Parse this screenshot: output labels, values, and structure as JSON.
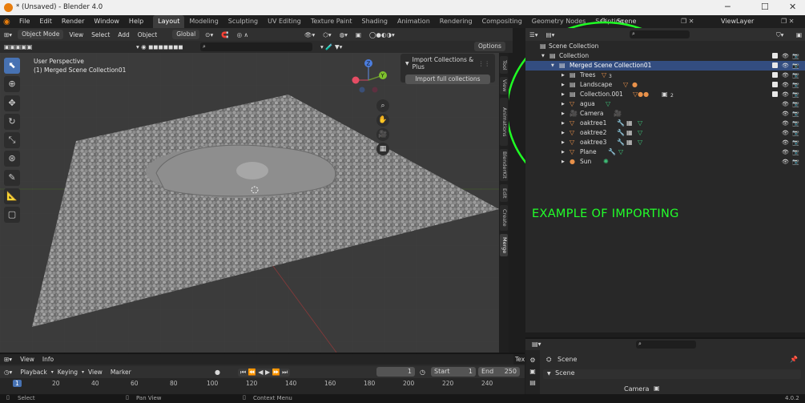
{
  "window": {
    "title": "* (Unsaved) - Blender 4.0"
  },
  "menu": [
    "File",
    "Edit",
    "Render",
    "Window",
    "Help"
  ],
  "workspaces": [
    "Layout",
    "Modeling",
    "Sculpting",
    "UV Editing",
    "Texture Paint",
    "Shading",
    "Animation",
    "Rendering",
    "Compositing",
    "Geometry Nodes",
    "Scripting"
  ],
  "scene_field": "Scene",
  "viewlayer_field": "ViewLayer",
  "vp_header": {
    "mode": "Object Mode",
    "menus": [
      "View",
      "Select",
      "Add",
      "Object"
    ],
    "orientation": "Global",
    "options": "Options"
  },
  "vp_info": {
    "line1": "User Perspective",
    "line2": "(1) Merged Scene Collection01"
  },
  "npanel": {
    "title": "Import Collections & Plus",
    "button": "Import full collections"
  },
  "side_tabs": [
    "Tool",
    "View",
    "Animations",
    "BlenderKit",
    "Edit",
    "Create",
    "Merge"
  ],
  "gizmo": {
    "x": "X",
    "y": "Y",
    "z": "Z"
  },
  "outliner": {
    "rows": [
      {
        "label": "Scene Collection",
        "indent": 0,
        "icon": "collection"
      },
      {
        "label": "Collection",
        "indent": 1,
        "icon": "collection"
      },
      {
        "label": "Merged Scene Collection01",
        "indent": 2,
        "icon": "collection",
        "selected": true
      },
      {
        "label": "Trees",
        "indent": 3,
        "icon": "collection",
        "badge": "3"
      },
      {
        "label": "Landscape",
        "indent": 3,
        "icon": "collection"
      },
      {
        "label": "Collection.001",
        "indent": 3,
        "icon": "collection",
        "badge": "2"
      },
      {
        "label": "agua",
        "indent": 3,
        "icon": "mesh"
      },
      {
        "label": "Camera",
        "indent": 3,
        "icon": "camera"
      },
      {
        "label": "oaktree1",
        "indent": 3,
        "icon": "mesh"
      },
      {
        "label": "oaktree2",
        "indent": 3,
        "icon": "mesh"
      },
      {
        "label": "oaktree3",
        "indent": 3,
        "icon": "mesh"
      },
      {
        "label": "Plane",
        "indent": 3,
        "icon": "mesh"
      },
      {
        "label": "Sun",
        "indent": 3,
        "icon": "light"
      }
    ]
  },
  "annotation": "EXAMPLE OF IMPORTING",
  "timeline": {
    "menus": [
      "View",
      "Info"
    ],
    "playback": "Playback",
    "keying": "Keying",
    "view": "View",
    "marker": "Marker",
    "current_frame": "1",
    "start_label": "Start",
    "start": "1",
    "end_label": "End",
    "end": "250",
    "ruler": [
      "1",
      "20",
      "40",
      "60",
      "80",
      "100",
      "120",
      "140",
      "160",
      "180",
      "200",
      "220",
      "240"
    ],
    "tex": "Tex"
  },
  "properties": {
    "title": "Scene",
    "section": "Scene",
    "camera_label": "Camera"
  },
  "status": {
    "select": "Select",
    "pan": "Pan View",
    "context": "Context Menu",
    "version": "4.0.2"
  }
}
